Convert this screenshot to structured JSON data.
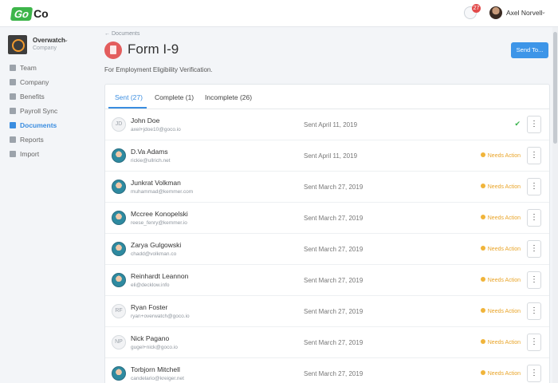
{
  "app": {
    "logo_go": "Go",
    "logo_co": "Co"
  },
  "header": {
    "notification_count": "27",
    "user_name": "Axel Norvell"
  },
  "sidebar": {
    "company_name": "Overwatch",
    "company_sub": "Company",
    "items": [
      {
        "label": "Team",
        "icon": "team-icon"
      },
      {
        "label": "Company",
        "icon": "company-icon"
      },
      {
        "label": "Benefits",
        "icon": "benefits-icon"
      },
      {
        "label": "Payroll Sync",
        "icon": "payroll-icon"
      },
      {
        "label": "Documents",
        "icon": "documents-icon",
        "active": true
      },
      {
        "label": "Reports",
        "icon": "reports-icon"
      },
      {
        "label": "Import",
        "icon": "import-icon"
      }
    ]
  },
  "main": {
    "back_link": "← Documents",
    "title": "Form I-9",
    "send_button": "Send To...",
    "description": "For Employment Eligibility Verification.",
    "tabs": [
      {
        "label": "Sent (27)",
        "active": true
      },
      {
        "label": "Complete (1)"
      },
      {
        "label": "Incomplete (26)"
      }
    ],
    "rows": [
      {
        "name": "John Doe",
        "email": "axel+jdoe10@goco.io",
        "sent": "Sent April 11, 2019",
        "status": "",
        "initials": "JD",
        "complete": true
      },
      {
        "name": "D.Va Adams",
        "email": "rickie@ullrich.net",
        "sent": "Sent April 11, 2019",
        "status": "Needs Action"
      },
      {
        "name": "Junkrat Volkman",
        "email": "muhammad@kemmer.com",
        "sent": "Sent March 27, 2019",
        "status": "Needs Action"
      },
      {
        "name": "Mccree Konopelski",
        "email": "reese_fenry@kemmer.io",
        "sent": "Sent March 27, 2019",
        "status": "Needs Action"
      },
      {
        "name": "Zarya Gulgowski",
        "email": "chadd@volkman.co",
        "sent": "Sent March 27, 2019",
        "status": "Needs Action"
      },
      {
        "name": "Reinhardt Leannon",
        "email": "eli@decklow.info",
        "sent": "Sent March 27, 2019",
        "status": "Needs Action"
      },
      {
        "name": "Ryan Foster",
        "email": "ryan+overwatch@goco.io",
        "sent": "Sent March 27, 2019",
        "status": "Needs Action",
        "initials": "RF"
      },
      {
        "name": "Nick Pagano",
        "email": "gugel+nick@goco.io",
        "sent": "Sent March 27, 2019",
        "status": "Needs Action",
        "initials": "NP"
      },
      {
        "name": "Torbjorn Mitchell",
        "email": "candelario@kreiger.net",
        "sent": "Sent March 27, 2019",
        "status": "Needs Action"
      }
    ]
  }
}
